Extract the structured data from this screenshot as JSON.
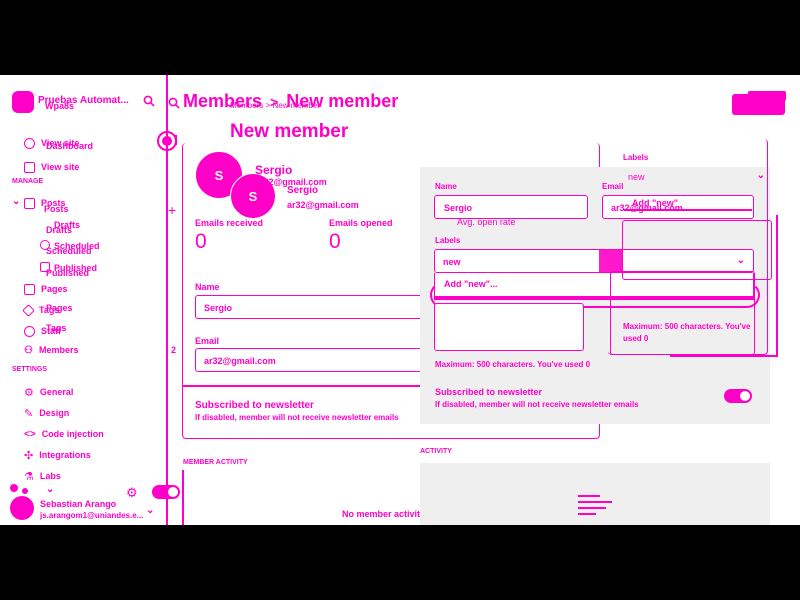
{
  "sidebar": {
    "site_title": "Pruebas Automat...",
    "site_title_ghost": "Wpa8s",
    "view_site_ghost": "View site",
    "dashboard_ghost": "Dashboard",
    "view_site": "View site",
    "manage_header": "MANAGE",
    "posts": "Posts",
    "posts_ghost": "Posts",
    "drafts": "Drafts",
    "drafts_ghost": "Drafts",
    "scheduled": "Scheduled",
    "scheduled_ghost": "Scheduled",
    "published": "Published",
    "published_ghost": "Published",
    "pages": "Pages",
    "pages_ghost": "Pages",
    "tags": "Tags",
    "tags_ghost": "Tags",
    "staff": "Staff",
    "members": "Members",
    "members_count": "2",
    "settings_header": "SETTINGS",
    "general": "General",
    "design": "Design",
    "code_injection": "Code injection",
    "integrations": "Integrations",
    "labs": "Labs",
    "user_name": "Sebastian Arango",
    "user_email": "js.arangom1@uniandes.e..."
  },
  "header": {
    "breadcrumb_members": "Members",
    "breadcrumb_sep": ">",
    "breadcrumb_new": "New member",
    "breadcrumb_ghost": "Members > New member",
    "page_title": "New member"
  },
  "member": {
    "avatar_initial": "S",
    "name": "Sergio",
    "email": "ar32@gmail.com",
    "name_ghost": "Sergio",
    "email_ghost": "ar32@gmail.com",
    "emails_received_label": "Emails received",
    "emails_received_value": "0",
    "emails_opened_label": "Emails opened",
    "emails_opened_value": "0",
    "avg_open_rate_label": "Avg. open rate"
  },
  "form_back": {
    "name_label": "Name",
    "name_value": "Sergio",
    "email_label": "Email",
    "email_value": "ar32@gmail.com",
    "subscribed_label": "Subscribed to newsletter",
    "subscribed_help": "If disabled, member will not receive newsletter emails",
    "member_activity_header": "MEMBER ACTIVITY",
    "no_activity": "No member activity yet"
  },
  "form_front": {
    "name_label": "Name",
    "name_value": "Sergio",
    "email_label": "Email",
    "email_value": "ar32@gmail.com",
    "labels_label": "Labels",
    "labels_value": "new",
    "add_label_option": "Add \"new\"...",
    "note_help": "Maximum: 500 characters. You've used 0",
    "subscribed_label": "Subscribed to newsletter",
    "subscribed_help": "If disabled, member will not receive newsletter emails",
    "activity_header": "ACTIVITY"
  },
  "right_panel": {
    "labels_label": "Labels",
    "labels_value": "new",
    "add_label_option": "Add \"new\"",
    "email_label": "Email",
    "email_value": "ar32@gmail.com",
    "note_help_line1": "Maximum: 500 characters. You've",
    "note_help_line2": "used 0"
  },
  "colors": {
    "accent": "#ff00c8",
    "background": "#ffffff",
    "letterbox": "#000000"
  },
  "icons": [
    "search-icon",
    "view-site-icon",
    "posts-icon",
    "pages-icon",
    "tags-icon",
    "staff-icon",
    "members-icon",
    "gear-icon",
    "design-icon",
    "code-icon",
    "integrations-icon",
    "labs-icon",
    "chevron-down-icon",
    "plus-icon"
  ]
}
